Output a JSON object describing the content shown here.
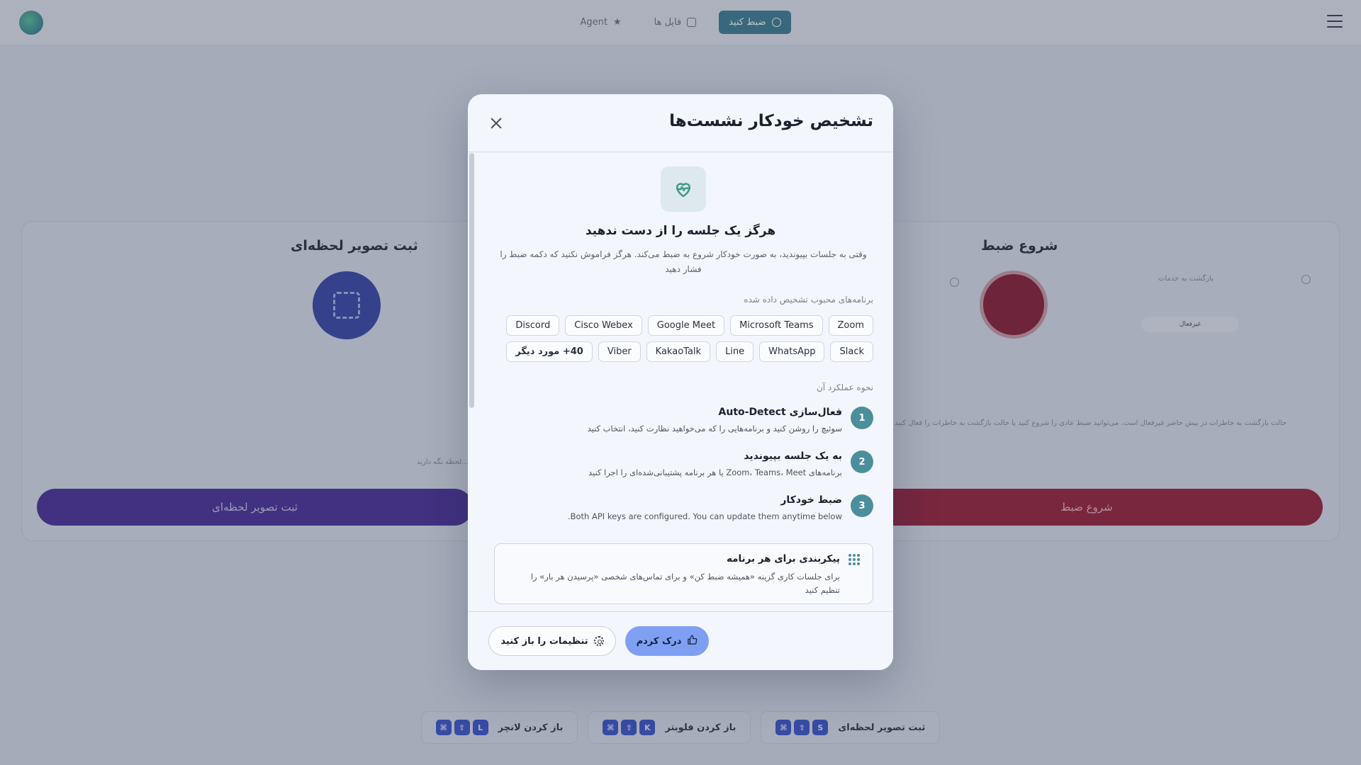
{
  "topbar": {
    "nav": [
      {
        "label": "ضبط کنید",
        "icon": "record-icon",
        "active": true
      },
      {
        "label": "فایل ها",
        "icon": "files-icon",
        "active": false
      },
      {
        "label": "Agent",
        "icon": "star-icon",
        "active": false
      }
    ]
  },
  "background": {
    "snapshot_title": "ثبت تصویر لحظه‌ای",
    "record_title": "شروع ضبط",
    "snapshot_button": "ثبت تصویر لحظه‌ای",
    "record_button": "شروع ضبط",
    "return_label": "بازگشت به خدمات",
    "inactive_label": "غیرفعال",
    "record_hint": "حالت بازگشت به خاطرات در بیش حاضر غیرفعال است. می‌توانید ضبط عادی را شروع کنید یا حالت بازگشت به خاطرات را فعال کنید",
    "snapshot_hint": "...لحظه نگه دارید"
  },
  "shortcuts": [
    {
      "label": "باز کردن لانچر",
      "keys": [
        "⌘",
        "⇧",
        "L"
      ]
    },
    {
      "label": "باز کردن فلوبتر",
      "keys": [
        "⌘",
        "⇧",
        "K"
      ]
    },
    {
      "label": "ثبت تصویر لحظه‌ای",
      "keys": [
        "⌘",
        "⇧",
        "S"
      ]
    }
  ],
  "modal": {
    "title": "تشخیص خودکار نشست‌ها",
    "hero_title": "هرگز یک جلسه را از دست ندهید",
    "hero_desc": "وقتی به جلسات بپیوندید، به صورت خودکار شروع به ضبط می‌کند. هرگز فراموش نکنید که دکمه ضبط را فشار دهید",
    "apps_label": "برنامه‌های محبوب تشخیص داده شده",
    "apps": [
      "Zoom",
      "Microsoft Teams",
      "Google Meet",
      "Cisco Webex",
      "Discord",
      "Slack",
      "WhatsApp",
      "Line",
      "KakaoTalk",
      "Viber",
      "40+ مورد دیگر"
    ],
    "how_label": "نحوه عملکرد آن",
    "steps": [
      {
        "num": "1",
        "title": "فعال‌سازی Auto-Detect",
        "desc": "سوئیچ را روشن کنید و برنامه‌هایی را که می‌خواهید نظارت کنید، انتخاب کنید"
      },
      {
        "num": "2",
        "title": "به یک جلسه بپیوندید",
        "desc": "برنامه‌های Zoom، Teams، Meet یا هر برنامه پشتیبانی‌شده‌ای را اجرا کنید"
      },
      {
        "num": "3",
        "title": "ضبط خودکار",
        "desc": "Both API keys are configured. You can update them anytime below."
      }
    ],
    "config_title": "پیکربندی برای هر برنامه",
    "config_desc": "برای جلسات کاری گزینه «همیشه ضبط کن» و برای تماس‌های شخصی «پرسیدن هر بار» را تنظیم کنید",
    "primary_button": "درک کردم",
    "secondary_button": "تنظیمات را باز کنید"
  },
  "colors": {
    "accent": "#7fa0f2",
    "step_badge": "#4b8f9d",
    "nav_active": "#3f7f93"
  }
}
